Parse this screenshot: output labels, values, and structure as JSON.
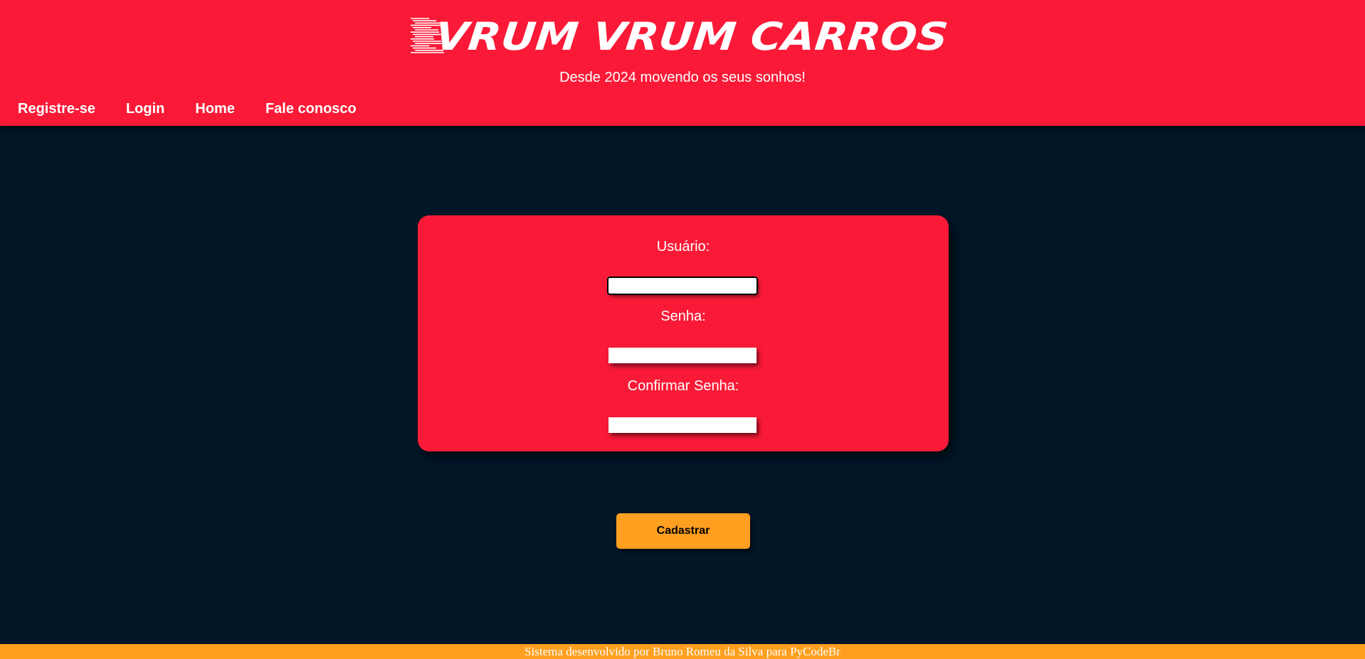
{
  "header": {
    "logo_text": "VRUM VRUM CARROS",
    "tagline": "Desde 2024 movendo os seus sonhos!",
    "nav": [
      {
        "label": "Registre-se"
      },
      {
        "label": "Login"
      },
      {
        "label": "Home"
      },
      {
        "label": "Fale conosco"
      }
    ]
  },
  "form": {
    "fields": [
      {
        "label": "Usuário:",
        "value": "",
        "focused": true
      },
      {
        "label": "Senha:",
        "value": ""
      },
      {
        "label": "Confirmar Senha:",
        "value": ""
      }
    ],
    "submit_label": "Cadastrar"
  },
  "footer": {
    "text": "Sistema desenvolvido por Bruno Romeu da Silva para PyCodeBr"
  },
  "colors": {
    "primary_red": "#fa1a37",
    "background_navy": "#011627",
    "accent_orange": "#fe9f1f",
    "text_white": "#ffffff"
  }
}
